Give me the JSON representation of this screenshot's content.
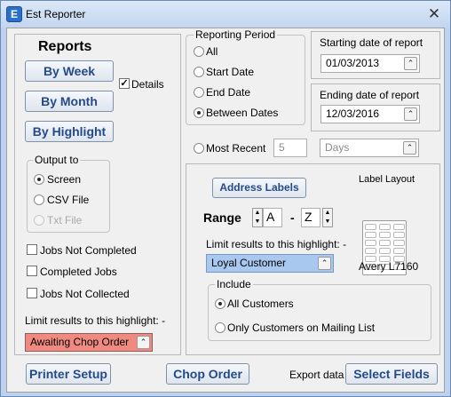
{
  "window": {
    "title": "Est Reporter",
    "icon": "E"
  },
  "reports": {
    "heading": "Reports",
    "by_week": "By Week",
    "by_month": "By Month",
    "by_highlight": "By Highlight",
    "details_label": "Details",
    "details_checked": true
  },
  "output_to": {
    "legend": "Output to",
    "options": [
      "Screen",
      "CSV File",
      "Txt File"
    ],
    "selected": "Screen"
  },
  "job_filters": [
    {
      "label": "Jobs Not Completed",
      "checked": false
    },
    {
      "label": "Completed Jobs",
      "checked": false
    },
    {
      "label": "Jobs Not Collected",
      "checked": false
    }
  ],
  "left_highlight": {
    "label": "Limit results to this highlight: -",
    "value": "Awaiting Chop Order"
  },
  "reporting_period": {
    "legend": "Reporting Period",
    "options": [
      "All",
      "Start Date",
      "End Date",
      "Between Dates"
    ],
    "selected": "Between Dates"
  },
  "start_date": {
    "label": "Starting date of report",
    "value": "01/03/2013"
  },
  "end_date": {
    "label": "Ending date of report",
    "value": "12/03/2016"
  },
  "most_recent": {
    "label": "Most Recent",
    "count": "5",
    "unit": "Days"
  },
  "address": {
    "button": "Address Labels",
    "label_layout": "Label Layout",
    "range_label": "Range",
    "range_from": "A",
    "range_dash": "-",
    "range_to": "Z",
    "highlight_label": "Limit results to this highlight: -",
    "highlight_value": "Loyal Customer",
    "layout_name": "Avery L7160"
  },
  "include": {
    "legend": "Include",
    "options": [
      "All Customers",
      "Only Customers on Mailing List"
    ],
    "selected": "All Customers"
  },
  "footer": {
    "printer_setup": "Printer Setup",
    "chop_order": "Chop Order",
    "export_label": "Export data",
    "select_fields": "Select Fields"
  },
  "colors": {
    "titlebar": "#c3d6ef",
    "button_text": "#254a8a",
    "highlight_left": "#f08a80",
    "highlight_right": "#a8c8f0"
  }
}
